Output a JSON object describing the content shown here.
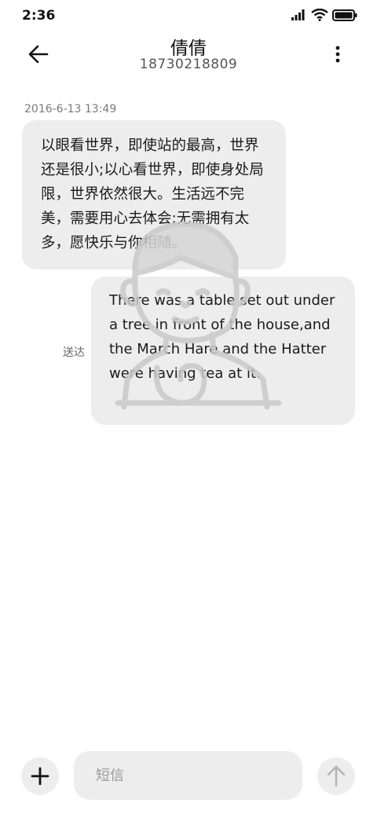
{
  "status_bar": {
    "time": "2:36",
    "icons": [
      "signal-icon",
      "wifi-icon",
      "battery-icon"
    ]
  },
  "header": {
    "back_icon": "arrow-left-icon",
    "contact_name": "倩倩",
    "phone_number": "18730218809",
    "more_icon": "more-vertical-icon"
  },
  "conversation": {
    "timestamp": "2016-6-13 13:49",
    "messages": [
      {
        "direction": "incoming",
        "text": "以眼看世界，即使站的最高，世界还是很小;以心看世界，即使身处局限，世界依然很大。生活远不完美，需要用心去体会;无需拥有太多，愿快乐与你相随。"
      },
      {
        "direction": "outgoing",
        "status": "送达",
        "text": "There was a table set out under a tree in front of the house,and the March Hare and the Hatter were having tea at it."
      }
    ]
  },
  "composer": {
    "attach_icon": "plus-icon",
    "placeholder": "短信",
    "value": "",
    "send_icon": "arrow-up-icon"
  },
  "colors": {
    "bubble": "#ededed",
    "background": "#ffffff",
    "timestamp": "#7a7a7a",
    "watermark": "#c9c9c9"
  }
}
